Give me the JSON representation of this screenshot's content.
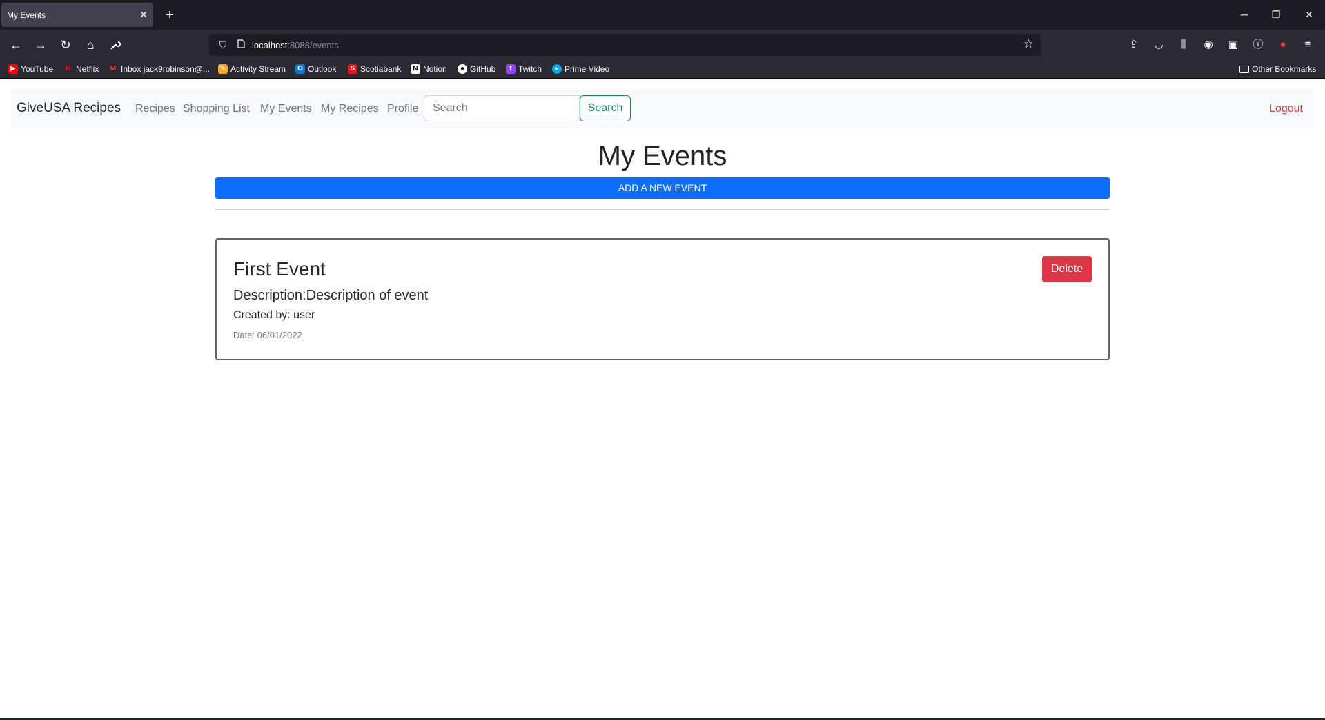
{
  "browser": {
    "tab_title": "My Events",
    "tab_close": "✕",
    "new_tab": "+",
    "url_host": "localhost",
    "url_path": ":8088/events",
    "window_controls": {
      "minimize": "─",
      "restore": "❐",
      "close": "✕"
    },
    "bookmarks": [
      {
        "label": "YouTube",
        "icon": "youtube-icon",
        "color": "#ff0000"
      },
      {
        "label": "Netflix",
        "icon": "netflix-icon",
        "color": "#e50914"
      },
      {
        "label": "Inbox jack9robinson@...",
        "icon": "gmail-icon",
        "color": "#ea4335"
      },
      {
        "label": "Activity Stream",
        "icon": "activity-icon",
        "color": "#f9a825"
      },
      {
        "label": "Outlook",
        "icon": "outlook-icon",
        "color": "#0078d4"
      },
      {
        "label": "Scotiabank",
        "icon": "scotiabank-icon",
        "color": "#ec111a"
      },
      {
        "label": "Notion",
        "icon": "notion-icon",
        "color": "#ffffff"
      },
      {
        "label": "GitHub",
        "icon": "github-icon",
        "color": "#ffffff"
      },
      {
        "label": "Twitch",
        "icon": "twitch-icon",
        "color": "#9146ff"
      },
      {
        "label": "Prime Video",
        "icon": "primevideo-icon",
        "color": "#00a8e1"
      }
    ],
    "other_bookmarks": "Other Bookmarks"
  },
  "app": {
    "brand": "GiveUSA Recipes",
    "nav": [
      "Recipes",
      "Shopping List",
      "My Events",
      "My Recipes",
      "Profile"
    ],
    "search_placeholder": "Search",
    "search_button": "Search",
    "logout": "Logout"
  },
  "main": {
    "title": "My Events",
    "add_button": "ADD A NEW EVENT",
    "events": [
      {
        "title": "First Event",
        "description": "Description:Description of event",
        "created_by": "Created by: user",
        "date": "Date: 06/01/2022",
        "delete_label": "Delete"
      }
    ]
  },
  "colors": {
    "primary": "#0d6efd",
    "danger": "#dc3545",
    "success": "#198754"
  }
}
